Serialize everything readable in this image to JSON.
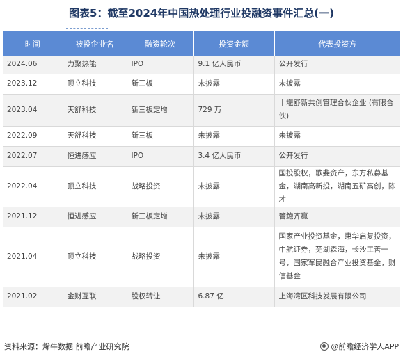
{
  "title": "图表5：截至2024年中国热处理行业投融资事件汇总(一)",
  "table": {
    "headers": [
      "时间",
      "被投企业名",
      "融资轮次",
      "投资金额",
      "代表投资方"
    ],
    "rows": [
      [
        "2024.06",
        "力聚热能",
        "IPO",
        "9.1 亿人民币",
        "公开发行"
      ],
      [
        "2023.12",
        "顶立科技",
        "新三板",
        "未披露",
        "未披露"
      ],
      [
        "2023.04",
        "天舒科技",
        "新三板定增",
        "729 万",
        "十堰舒新共创管理合伙企业 (有限合伙)"
      ],
      [
        "2022.09",
        "天舒科技",
        "新三板",
        "未披露",
        "未披露"
      ],
      [
        "2022.07",
        "恒进感应",
        "IPO",
        "3.4 亿人民币",
        "公开发行"
      ],
      [
        "2022.04",
        "顶立科技",
        "战略投资",
        "未披露",
        "国投股权，歌斐资产，东方私募基金，湖南高新投，湖南五矿高创，陈才"
      ],
      [
        "2021.12",
        "恒进感应",
        "新三板定增",
        "未披露",
        "管鲍齐赢"
      ],
      [
        "2021.04",
        "顶立科技",
        "战略投资",
        "未披露",
        "国家产业投资基金，惠华启复投资，中航证券，芜湖森海，长沙工善一号，国家军民融合产业投资基金，财信基金"
      ],
      [
        "2021.02",
        "金财互联",
        "股权转让",
        "6.87 亿",
        "上海湾区科技发展有限公司"
      ]
    ]
  },
  "footer": {
    "source": "资料来源：烯牛数据 前瞻产业研究院",
    "brand": "@前瞻经济学人APP"
  }
}
